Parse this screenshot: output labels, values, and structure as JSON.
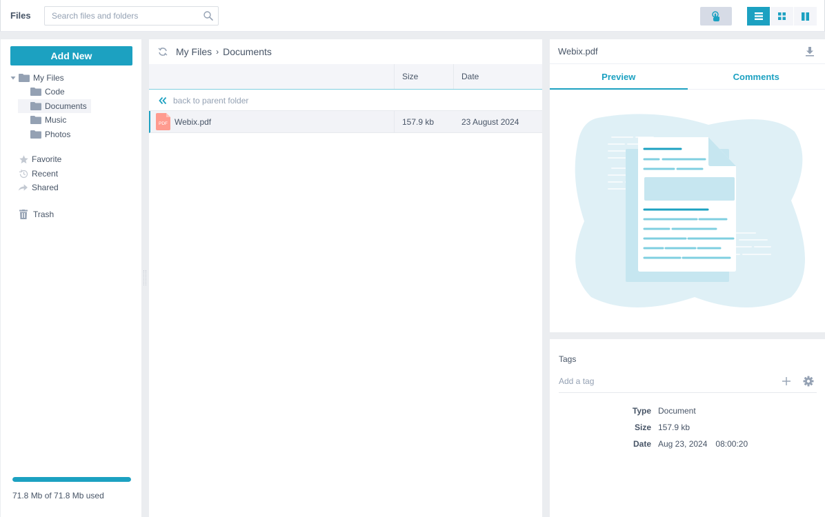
{
  "app": {
    "title": "Files"
  },
  "search": {
    "placeholder": "Search files and folders",
    "value": ""
  },
  "toolbar": {
    "touch_mode_icon": "touch-icon",
    "views": [
      {
        "name": "list",
        "icon": "list-icon",
        "active": true
      },
      {
        "name": "cards",
        "icon": "grid-icon",
        "active": false
      },
      {
        "name": "columns",
        "icon": "columns-icon",
        "active": false
      }
    ]
  },
  "sidebar": {
    "add_new_label": "Add New",
    "tree": [
      {
        "label": "My Files",
        "level": 0,
        "expanded": true,
        "selected": false
      },
      {
        "label": "Code",
        "level": 1,
        "selected": false
      },
      {
        "label": "Documents",
        "level": 1,
        "selected": true
      },
      {
        "label": "Music",
        "level": 1,
        "selected": false
      },
      {
        "label": "Photos",
        "level": 1,
        "selected": false
      }
    ],
    "nav": [
      {
        "label": "Favorite",
        "icon": "star-icon"
      },
      {
        "label": "Recent",
        "icon": "history-icon"
      },
      {
        "label": "Shared",
        "icon": "share-icon"
      },
      {
        "label": "Trash",
        "icon": "trash-icon"
      }
    ],
    "usage": {
      "text": "71.8 Mb of 71.8 Mb used",
      "used_fraction": 1.0
    }
  },
  "center": {
    "breadcrumb": [
      "My Files",
      "Documents"
    ],
    "columns": {
      "name": "",
      "size": "Size",
      "date": "Date"
    },
    "back_label": "back to parent folder",
    "files": [
      {
        "name": "Webix.pdf",
        "type_badge": "PDF",
        "size": "157.9 kb",
        "date": "23 August 2024",
        "selected": true
      }
    ]
  },
  "details": {
    "title": "Webix.pdf",
    "tabs": [
      {
        "label": "Preview",
        "active": true
      },
      {
        "label": "Comments",
        "active": false
      }
    ],
    "tags_label": "Tags",
    "tag_placeholder": "Add a tag",
    "meta": [
      {
        "label": "Type",
        "value": "Document"
      },
      {
        "label": "Size",
        "value": "157.9 kb"
      },
      {
        "label": "Date",
        "value": "Aug 23, 2024",
        "time": "08:00:20"
      }
    ]
  },
  "colors": {
    "accent": "#1ca1c1",
    "text": "#475466",
    "muted": "#94a1b3",
    "folder": "#94a1b3",
    "pdf": "#ff8f8f"
  }
}
